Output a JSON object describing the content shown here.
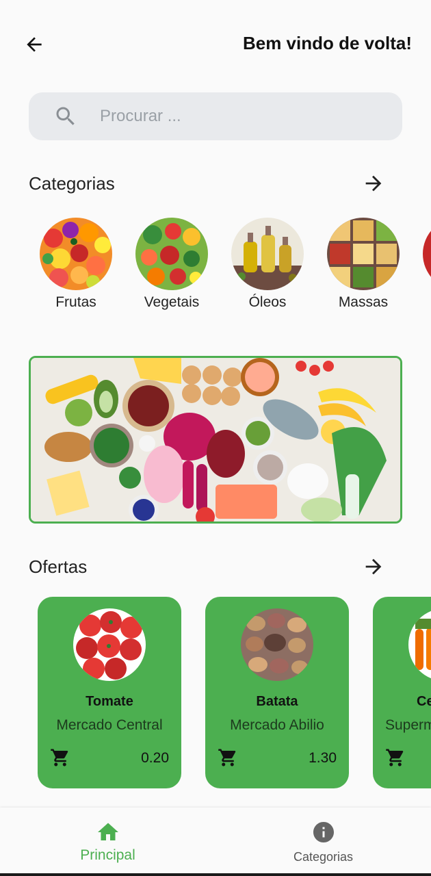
{
  "header": {
    "welcome": "Bem vindo de volta!",
    "back_icon": "arrow-left-icon"
  },
  "search": {
    "placeholder": "Procurar ...",
    "value": ""
  },
  "categories_section": {
    "title": "Categorias",
    "items": [
      {
        "label": "Frutas",
        "icon": "fruits-image"
      },
      {
        "label": "Vegetais",
        "icon": "vegetables-image"
      },
      {
        "label": "Óleos",
        "icon": "oils-image"
      },
      {
        "label": "Massas",
        "icon": "pasta-image"
      }
    ]
  },
  "offers_section": {
    "title": "Ofertas",
    "items": [
      {
        "name": "Tomate",
        "store": "Mercado Central",
        "price": "0.20",
        "image": "tomato-image"
      },
      {
        "name": "Batata",
        "store": "Mercado Abilio",
        "price": "1.30",
        "image": "potato-image"
      },
      {
        "name": "Ce",
        "store": "Superm",
        "price": "",
        "image": "carrot-image"
      }
    ]
  },
  "bottom_nav": {
    "items": [
      {
        "label": "Principal",
        "icon": "home-icon",
        "active": true
      },
      {
        "label": "Categorias",
        "icon": "info-icon",
        "active": false
      }
    ]
  },
  "colors": {
    "accent": "#4caf50",
    "search_bg": "#e8eaed",
    "background": "#fafafa"
  }
}
